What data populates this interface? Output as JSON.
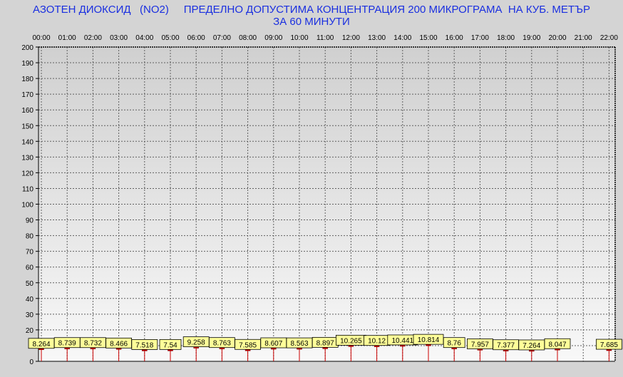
{
  "title_line_1": "АЗОТЕН ДИОКСИД   (NO2)     ПРЕДЕЛНО ДОПУСТИМА КОНЦЕНТРАЦИЯ 200 МИКРОГРАМА  НА КУБ. МЕТЪР",
  "title_line_2": "ЗА 60 МИНУТИ",
  "colors": {
    "background": "#d4d4d4",
    "title": "#1a2fe0",
    "marker": "#cc0000",
    "label_fill": "#ffff99",
    "grid": "#606060"
  },
  "chart_data": {
    "type": "bar",
    "title": "АЗОТЕН ДИОКСИД   (NO2)     ПРЕДЕЛНО ДОПУСТИМА КОНЦЕНТРАЦИЯ 200 МИКРОГРАМА  НА КУБ. МЕТЪР ЗА 60 МИНУТИ",
    "xlabel": "",
    "ylabel": "",
    "ylim": [
      0,
      200
    ],
    "grid": true,
    "y_ticks": [
      0,
      10,
      20,
      30,
      40,
      50,
      60,
      70,
      80,
      90,
      100,
      110,
      120,
      130,
      140,
      150,
      160,
      170,
      180,
      190,
      200
    ],
    "y_tick_labels": [
      "0",
      "",
      "20",
      "30",
      "40",
      "50",
      "60",
      "70",
      "80",
      "90",
      "100",
      "110",
      "120",
      "130",
      "140",
      "150",
      "160",
      "170",
      "180",
      "190",
      "200"
    ],
    "categories": [
      "00:00",
      "01:00",
      "02:00",
      "03:00",
      "04:00",
      "05:00",
      "06:00",
      "07:00",
      "08:00",
      "09:00",
      "10:00",
      "11:00",
      "12:00",
      "13:00",
      "14:00",
      "15:00",
      "16:00",
      "17:00",
      "18:00",
      "19:00",
      "20:00",
      "21:00",
      "22:00"
    ],
    "values": [
      8.264,
      8.739,
      8.732,
      8.466,
      7.518,
      7.54,
      9.258,
      8.763,
      7.585,
      8.607,
      8.563,
      8.897,
      10.265,
      10.12,
      10.441,
      10.814,
      8.76,
      7.957,
      7.377,
      7.264,
      8.047,
      null,
      7.685
    ],
    "value_labels": [
      "8.264",
      "8.739",
      "8.732",
      "8.466",
      "7.518",
      "7.54",
      "9.258",
      "8.763",
      "7.585",
      "8.607",
      "8.563",
      "8.897",
      "10.265",
      "10.12",
      "10.441",
      "10.814",
      "8.76",
      "7.957",
      "7.377",
      "7.264",
      "8.047",
      "",
      "7.685"
    ]
  }
}
